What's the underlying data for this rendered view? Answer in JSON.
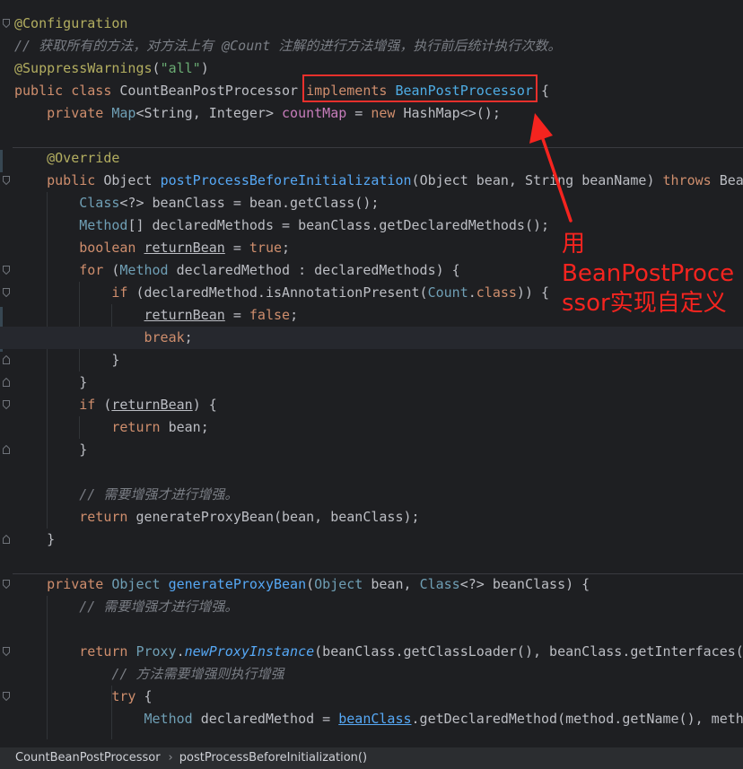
{
  "code": {
    "l1_annotation": "@Configuration",
    "l2_comment": "// 获取所有的方法，对方法上有 @Count 注解的进行方法增强，执行前后统计执行次数。",
    "l3_suppress": "@SuppressWarnings",
    "l3_arg": "\"all\"",
    "l4_public": "public",
    "l4_class": "class",
    "l4_name": "CountBeanPostProcessor",
    "l4_implements": "implements",
    "l4_iface": "BeanPostProcessor",
    "l5_private": "private",
    "l5_map": "Map",
    "l5_string": "String",
    "l5_integer": "Integer",
    "l5_field": "countMap",
    "l5_new": "new",
    "l5_hashmap": "HashMap",
    "override": "@Override",
    "m1_public": "public",
    "m1_type": "Object",
    "m1_name": "postProcessBeforeInitialization",
    "m1_ptype1": "Object",
    "m1_p1": "bean",
    "m1_ptype2": "String",
    "m1_p2": "beanName",
    "m1_throws": "throws",
    "m1_ex": "Bean",
    "a1_class": "Class",
    "a1_var": "beanClass",
    "a1_rhs": "bean.getClass();",
    "a2_method": "Method",
    "a2_var": "declaredMethods",
    "a2_rhs": "beanClass.getDeclaredMethods();",
    "a3_boolean": "boolean",
    "a3_var": "returnBean",
    "a3_true": "true",
    "a4_for": "for",
    "a4_method": "Method",
    "a4_var": "declaredMethod",
    "a4_iter": "declaredMethods",
    "a5_if": "if",
    "a5_call": "declaredMethod.isAnnotationPresent(",
    "a5_count": "Count",
    "a5_class": "class",
    "a6_var": "returnBean",
    "a6_false": "false",
    "a7_break": "break",
    "a8_if": "if",
    "a8_var": "returnBean",
    "a9_return": "return",
    "a9_bean": "bean;",
    "c1_comment": "// 需要增强才进行增强。",
    "c2_return": "return",
    "c2_call": "generateProxyBean(bean, beanClass);",
    "m2_private": "private",
    "m2_type": "Object",
    "m2_name": "generateProxyBean",
    "m2_ptype1": "Object",
    "m2_p1": "bean",
    "m2_ptype2": "Class",
    "m2_p2": "beanClass",
    "m2_comment": "// 需要增强才进行增强。",
    "p1_return": "return",
    "p1_proxy": "Proxy",
    "p1_new": "newProxyInstance",
    "p1_args": "(beanClass.getClassLoader(), beanClass.getInterfaces()",
    "p2_comment": "// 方法需要增强则执行增强",
    "p3_try": "try",
    "p4_method": "Method",
    "p4_var": "declaredMethod",
    "p4_bc": "beanClass",
    "p4_rest": ".getDeclaredMethod(method.getName(), metho"
  },
  "annotation": {
    "text_line1": "用",
    "text_line2": "BeanPostProce",
    "text_line3": "ssor实现自定义",
    "color": "#f5241f"
  },
  "statusbar": {
    "crumb_class": "CountBeanPostProcessor",
    "crumb_sep": "›",
    "crumb_method": "postProcessBeforeInitialization()"
  }
}
